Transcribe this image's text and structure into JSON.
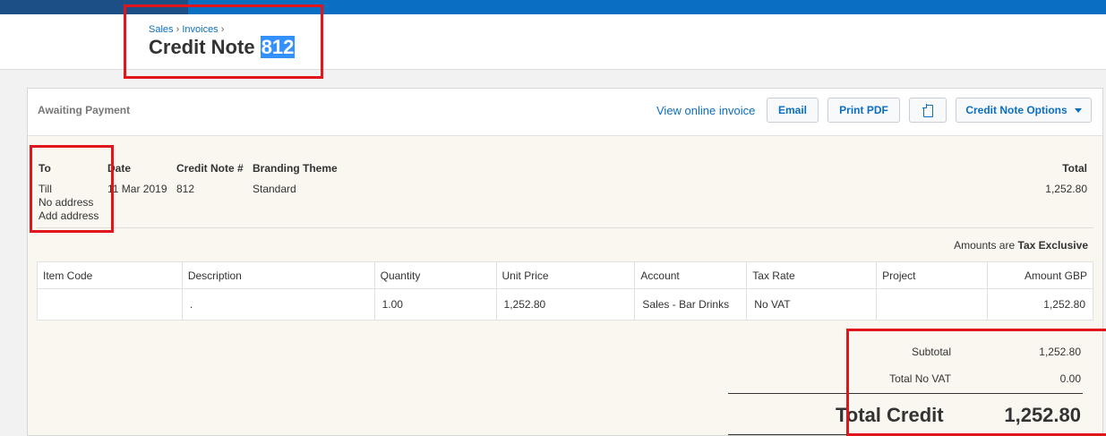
{
  "breadcrumb": [
    "Sales",
    "Invoices"
  ],
  "breadcrumb_sep": "›",
  "title": {
    "prefix": "Credit Note",
    "number": "812"
  },
  "status": "Awaiting Payment",
  "actions": {
    "view_online": "View online invoice",
    "email": "Email",
    "print_pdf": "Print PDF",
    "copy_icon": "copy-icon",
    "options": "Credit Note Options"
  },
  "details": {
    "to_label": "To",
    "to_name": "Till",
    "no_address": "No address",
    "add_address": "Add address",
    "date_label": "Date",
    "date_value": "11 Mar 2019",
    "number_label": "Credit Note #",
    "number_value": "812",
    "theme_label": "Branding Theme",
    "theme_value": "Standard",
    "total_label": "Total",
    "total_value": "1,252.80"
  },
  "amounts_note": {
    "prefix": "Amounts are",
    "mode": "Tax Exclusive"
  },
  "table": {
    "columns": [
      "Item Code",
      "Description",
      "Quantity",
      "Unit Price",
      "Account",
      "Tax Rate",
      "Project",
      "Amount GBP"
    ],
    "rows": [
      [
        "",
        ".",
        "1.00",
        "1,252.80",
        "Sales - Bar Drinks",
        "No VAT",
        "",
        "1,252.80"
      ]
    ]
  },
  "totals": {
    "subtotal_label": "Subtotal",
    "subtotal_value": "1,252.80",
    "tax_label": "Total No VAT",
    "tax_value": "0.00",
    "grand_label": "Total Credit",
    "grand_value": "1,252.80"
  },
  "colors": {
    "accent": "#0b6fc1",
    "highlight": "#e0161b",
    "panel": "#faf6f0"
  }
}
